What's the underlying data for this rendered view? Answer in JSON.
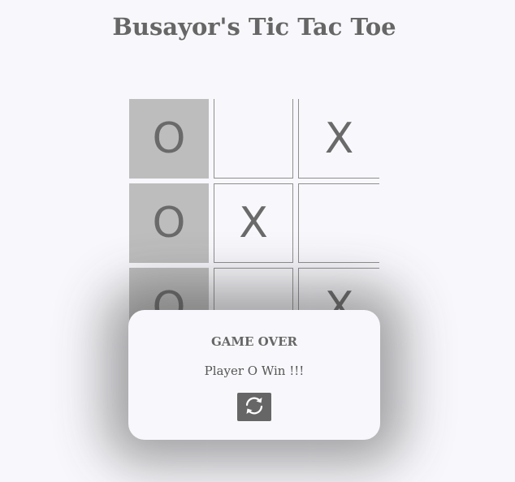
{
  "title": "Busayor's Tic Tac Toe",
  "board": {
    "cells": [
      {
        "mark": "O",
        "winning": true
      },
      {
        "mark": "",
        "winning": false
      },
      {
        "mark": "X",
        "winning": false
      },
      {
        "mark": "O",
        "winning": true
      },
      {
        "mark": "X",
        "winning": false
      },
      {
        "mark": "",
        "winning": false
      },
      {
        "mark": "O",
        "winning": true
      },
      {
        "mark": "",
        "winning": false
      },
      {
        "mark": "X",
        "winning": false
      }
    ]
  },
  "modal": {
    "title": "GAME OVER",
    "message": "Player O Win !!!",
    "restart_icon": "restart-icon"
  },
  "colors": {
    "background": "#f8f8fc",
    "text": "#666666",
    "winning_cell": "#bdbdbd",
    "button": "#666666"
  }
}
